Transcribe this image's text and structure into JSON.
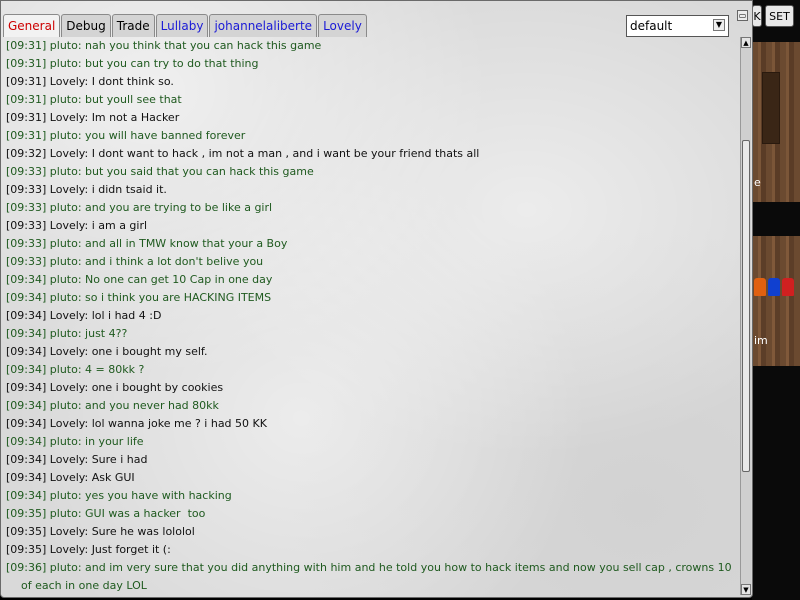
{
  "game_background": {
    "buttons": {
      "partial_x_label": "K",
      "set_label": "SET"
    },
    "caption_fragment": "im",
    "shirt_colors": [
      "#e06010",
      "#1040d0",
      "#d02020"
    ]
  },
  "chat": {
    "tabs": [
      {
        "label": "General",
        "color": "#cc0000",
        "active": true
      },
      {
        "label": "Debug",
        "color": "#000000",
        "active": false
      },
      {
        "label": "Trade",
        "color": "#000000",
        "active": false
      },
      {
        "label": "Lullaby",
        "color": "#1a1ad6",
        "active": false
      },
      {
        "label": "johannelaliberte",
        "color": "#1a1ad6",
        "active": false
      },
      {
        "label": "Lovely",
        "color": "#1a1ad6",
        "active": false
      }
    ],
    "channel_select": {
      "value": "default"
    },
    "colors": {
      "pluto": "#1f5a1f",
      "lovely": "#111111"
    },
    "messages": [
      {
        "speaker": "pluto",
        "text": "[09:31] pluto: nah you think that you can hack this game"
      },
      {
        "speaker": "pluto",
        "text": "[09:31] pluto: but you can try to do that thing"
      },
      {
        "speaker": "lovely",
        "text": "[09:31] Lovely: I dont think so."
      },
      {
        "speaker": "pluto",
        "text": "[09:31] pluto: but youll see that"
      },
      {
        "speaker": "lovely",
        "text": "[09:31] Lovely: Im not a Hacker"
      },
      {
        "speaker": "pluto",
        "text": "[09:31] pluto: you will have banned forever"
      },
      {
        "speaker": "lovely",
        "text": "[09:32] Lovely: I dont want to hack , im not a man , and i want be your friend thats all"
      },
      {
        "speaker": "pluto",
        "text": "[09:33] pluto: but you said that you can hack this game"
      },
      {
        "speaker": "lovely",
        "text": "[09:33] Lovely: i didn tsaid it."
      },
      {
        "speaker": "pluto",
        "text": "[09:33] pluto: and you are trying to be like a girl"
      },
      {
        "speaker": "lovely",
        "text": "[09:33] Lovely: i am a girl"
      },
      {
        "speaker": "pluto",
        "text": "[09:33] pluto: and all in TMW know that your a Boy"
      },
      {
        "speaker": "pluto",
        "text": "[09:33] pluto: and i think a lot don't belive you"
      },
      {
        "speaker": "pluto",
        "text": "[09:34] pluto: No one can get 10 Cap in one day"
      },
      {
        "speaker": "pluto",
        "text": "[09:34] pluto: so i think you are HACKING ITEMS"
      },
      {
        "speaker": "lovely",
        "text": "[09:34] Lovely: lol i had 4 :D"
      },
      {
        "speaker": "pluto",
        "text": "[09:34] pluto: just 4??"
      },
      {
        "speaker": "lovely",
        "text": "[09:34] Lovely: one i bought my self."
      },
      {
        "speaker": "pluto",
        "text": "[09:34] pluto: 4 = 80kk ?"
      },
      {
        "speaker": "lovely",
        "text": "[09:34] Lovely: one i bought by cookies"
      },
      {
        "speaker": "pluto",
        "text": "[09:34] pluto: and you never had 80kk"
      },
      {
        "speaker": "lovely",
        "text": "[09:34] Lovely: lol wanna joke me ? i had 50 KK"
      },
      {
        "speaker": "pluto",
        "text": "[09:34] pluto: in your life"
      },
      {
        "speaker": "lovely",
        "text": "[09:34] Lovely: Sure i had"
      },
      {
        "speaker": "lovely",
        "text": "[09:34] Lovely: Ask GUI"
      },
      {
        "speaker": "pluto",
        "text": "[09:34] pluto: yes you have with hacking"
      },
      {
        "speaker": "pluto",
        "text": "[09:35] pluto: GUI was a hacker  too"
      },
      {
        "speaker": "lovely",
        "text": "[09:35] Lovely: Sure he was lololol"
      },
      {
        "speaker": "lovely",
        "text": "[09:35] Lovely: Just forget it (:"
      },
      {
        "speaker": "pluto",
        "text": "[09:36] pluto: and im very sure that you did anything with him and he told you how to hack items and now you sell cap , crowns 10",
        "continuation": "of each in one day LOL"
      }
    ],
    "scrollbar": {
      "position": 0.45,
      "visible_fraction": 0.62
    }
  }
}
